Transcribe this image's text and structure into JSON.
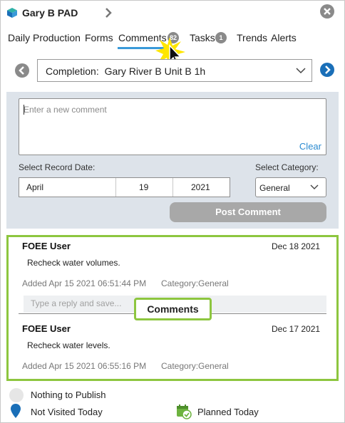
{
  "header": {
    "title": "Gary B PAD",
    "icons": {
      "logo": "stack-logo-icon",
      "forward": "chevron-right-icon",
      "close": "close-circle-icon"
    }
  },
  "tabs": [
    {
      "label": "Daily Production"
    },
    {
      "label": "Forms"
    },
    {
      "label": "Comments",
      "badge": "82",
      "active": true
    },
    {
      "label": "Tasks",
      "badge": "1"
    },
    {
      "label": "Trends"
    },
    {
      "label": "Alerts"
    }
  ],
  "completion": {
    "label": "Completion:",
    "value": "Gary River B Unit B 1h"
  },
  "comment_form": {
    "placeholder": "Enter a new comment",
    "clear_label": "Clear",
    "record_date_label": "Select Record Date:",
    "date": {
      "month": "April",
      "day": "19",
      "year": "2021"
    },
    "category_label": "Select Category:",
    "category_value": "General",
    "post_label": "Post Comment"
  },
  "comments": [
    {
      "user": "FOEE User",
      "date": "Dec 18 2021",
      "text": "Recheck water volumes.",
      "added": "Added Apr 15 2021 06:51:44 PM",
      "category": "Category:General"
    },
    {
      "user": "FOEE User",
      "date": "Dec 17 2021",
      "text": "Recheck water levels.",
      "added": "Added Apr 15 2021 06:55:16 PM",
      "category": "Category:General"
    }
  ],
  "reply_placeholder": "Type a reply and save...",
  "tooltip": "Comments",
  "legend": {
    "publish": "Nothing to Publish",
    "not_visited": "Not Visited Today",
    "planned": "Planned Today"
  },
  "colors": {
    "accent_blue": "#1a6fb8",
    "link_blue": "#2a8ad0",
    "highlight_green": "#8dc63f",
    "panel_bg": "#dde3ea"
  }
}
